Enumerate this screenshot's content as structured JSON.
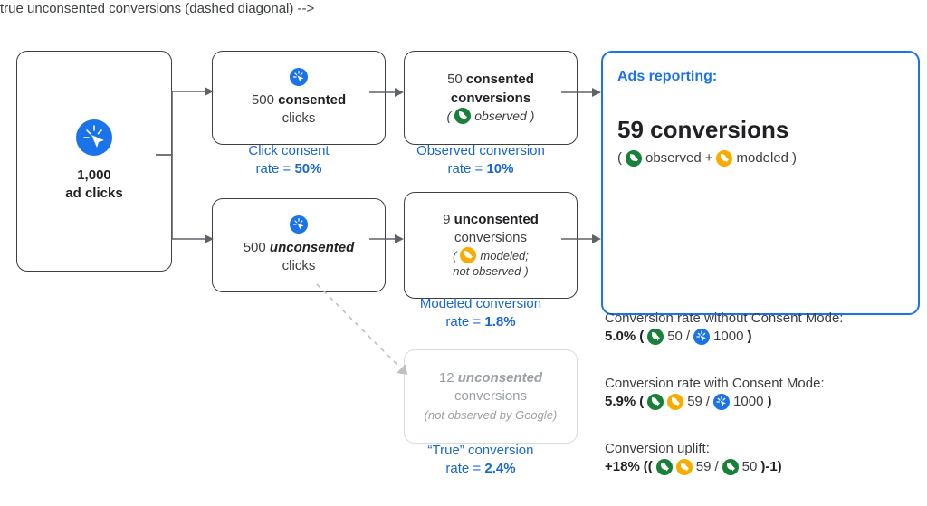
{
  "chart_data": {
    "type": "table",
    "title": "Consent Mode conversion modeling flow",
    "nodes": [
      {
        "id": "ad_clicks",
        "value": 1000,
        "label": "ad clicks"
      },
      {
        "id": "consented_clicks",
        "value": 500,
        "label": "consented clicks"
      },
      {
        "id": "unconsented_clicks",
        "value": 500,
        "label": "unconsented clicks"
      },
      {
        "id": "consented_conversions",
        "value": 50,
        "label": "consented conversions",
        "tag": "observed"
      },
      {
        "id": "unconsented_conversions_modeled",
        "value": 9,
        "label": "unconsented conversions",
        "tag": "modeled; not observed"
      },
      {
        "id": "unconsented_conversions_true",
        "value": 12,
        "label": "unconsented conversions",
        "tag": "not observed by Google"
      },
      {
        "id": "ads_reporting",
        "value": 59,
        "label": "conversions"
      }
    ],
    "rates": {
      "click_consent_rate": 0.5,
      "observed_conversion_rate": 0.1,
      "modeled_conversion_rate": 0.018,
      "true_conversion_rate": 0.024,
      "without_consent_mode": 0.05,
      "with_consent_mode": 0.059,
      "uplift": 0.18
    }
  },
  "col1": {
    "ad_clicks_value": "1,000",
    "ad_clicks_label": "ad clicks"
  },
  "row_top": {
    "consented_value": "500",
    "consented_word": "consented",
    "consented_unit": "clicks",
    "conv_value": "50",
    "conv_word": "consented",
    "conv_unit": "conversions",
    "conv_tag": "observed"
  },
  "row_bot": {
    "unconsented_value": "500",
    "unconsented_word": "unconsented",
    "unconsented_unit": "clicks",
    "conv_value": "9",
    "conv_word": "unconsented",
    "conv_unit": "conversions",
    "conv_tag_a": "modeled;",
    "conv_tag_b": "not observed"
  },
  "ghost": {
    "value": "12",
    "word": "unconsented",
    "unit": "conversions",
    "tag": "(not observed by Google)"
  },
  "labels": {
    "consent_rate_a": "Click consent",
    "consent_rate_b": "rate = ",
    "consent_rate_v": "50%",
    "obs_rate_a": "Observed conversion",
    "obs_rate_b": "rate = ",
    "obs_rate_v": "10%",
    "mod_rate_a": "Modeled conversion",
    "mod_rate_b": "rate = ",
    "mod_rate_v": "1.8%",
    "true_rate_a": "“True” conversion",
    "true_rate_b": "rate = ",
    "true_rate_v": "2.4%"
  },
  "ads": {
    "title": "Ads reporting:",
    "big": "59 conversions",
    "sub_a": "(",
    "sub_obs": "observed",
    "sub_plus": " + ",
    "sub_mod": "modeled",
    "sub_b": ")"
  },
  "notes": {
    "without_a": "Conversion rate without Consent Mode:",
    "without_v": "5.0%",
    "without_b1": " (",
    "without_n1": "50",
    "without_b2": " / ",
    "without_n2": "1000",
    "without_b3": ")",
    "with_a": "Conversion rate with Consent Mode:",
    "with_v": "5.9%",
    "with_n1": "59",
    "with_n2": "1000",
    "uplift_a": "Conversion uplift:",
    "uplift_v": "+18%",
    "uplift_b1": " ((",
    "uplift_n1": "59",
    "uplift_b2": " / ",
    "uplift_n2": "50",
    "uplift_b3": ")-1)"
  }
}
